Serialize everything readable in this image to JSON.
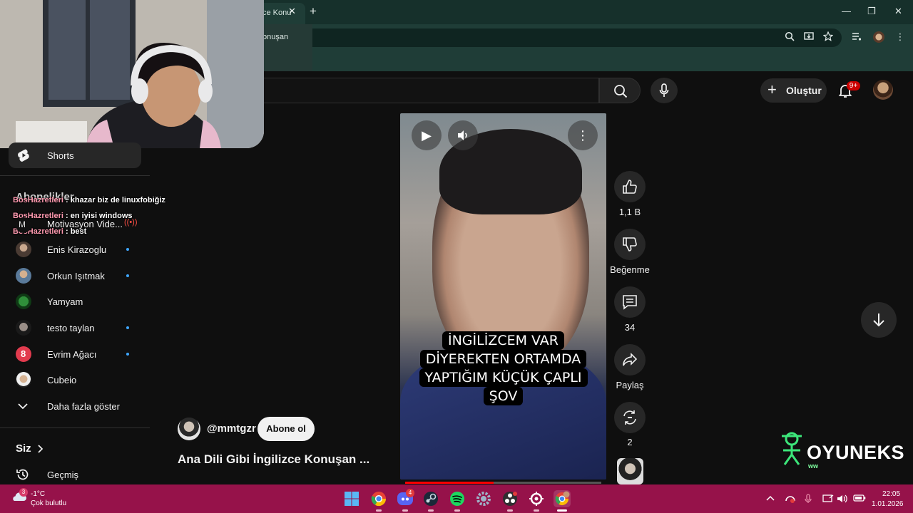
{
  "browser": {
    "tab_title": "ce Konu",
    "popup_text": "onuşan",
    "new_tab": "+",
    "tab_close": "✕",
    "window_controls": [
      "—",
      "❐",
      "✕"
    ]
  },
  "header": {
    "create_label": "Oluştur",
    "notification_count": "9+"
  },
  "sidebar": {
    "shorts_label": "Shorts",
    "subscriptions_title": "Abonelikler",
    "subscriptions": [
      {
        "name": "Motivasyon Vide...",
        "live": true
      },
      {
        "name": "Enis Kirazoglu",
        "new": true
      },
      {
        "name": "Orkun Işıtmak",
        "new": true
      },
      {
        "name": "Yamyam",
        "new": false
      },
      {
        "name": "testo taylan",
        "new": true
      },
      {
        "name": "Evrim Ağacı",
        "new": true
      },
      {
        "name": "Cubeio",
        "new": false
      }
    ],
    "show_more": "Daha fazla göster",
    "you_title": "Siz",
    "history": "Geçmiş"
  },
  "chat": [
    {
      "user": "BosHazretleri",
      "message": " : khazar biz de linuxfobiğiz"
    },
    {
      "user": "BosHazretleri",
      "message": " : en iyisi windows"
    },
    {
      "user": "BosHazretleri",
      "message": " : best"
    }
  ],
  "short": {
    "caption_lines": [
      "İNGİLİZCEM VAR",
      "DİYEREKTEN ORTAMDA",
      "YAPTIĞIM KÜÇÜK ÇAPLI",
      "ŞOV"
    ],
    "progress": 0.45,
    "channel": "@mmtgzr",
    "subscribe": "Abone ol",
    "title": "Ana Dili Gibi İngilizce Konuşan ...",
    "likes": "1,1 B",
    "dislike_label": "Beğenme",
    "comments": "34",
    "share_label": "Paylaş",
    "remix_count": "2"
  },
  "watermark": {
    "brand": "OYUNEKS",
    "sub": "ww"
  },
  "taskbar": {
    "weather_badge": "3",
    "temperature": "-1°C",
    "weather_desc": "Çok bulutlu",
    "discord_badge": "4",
    "time": "22:05",
    "date": "1.01.2026"
  }
}
